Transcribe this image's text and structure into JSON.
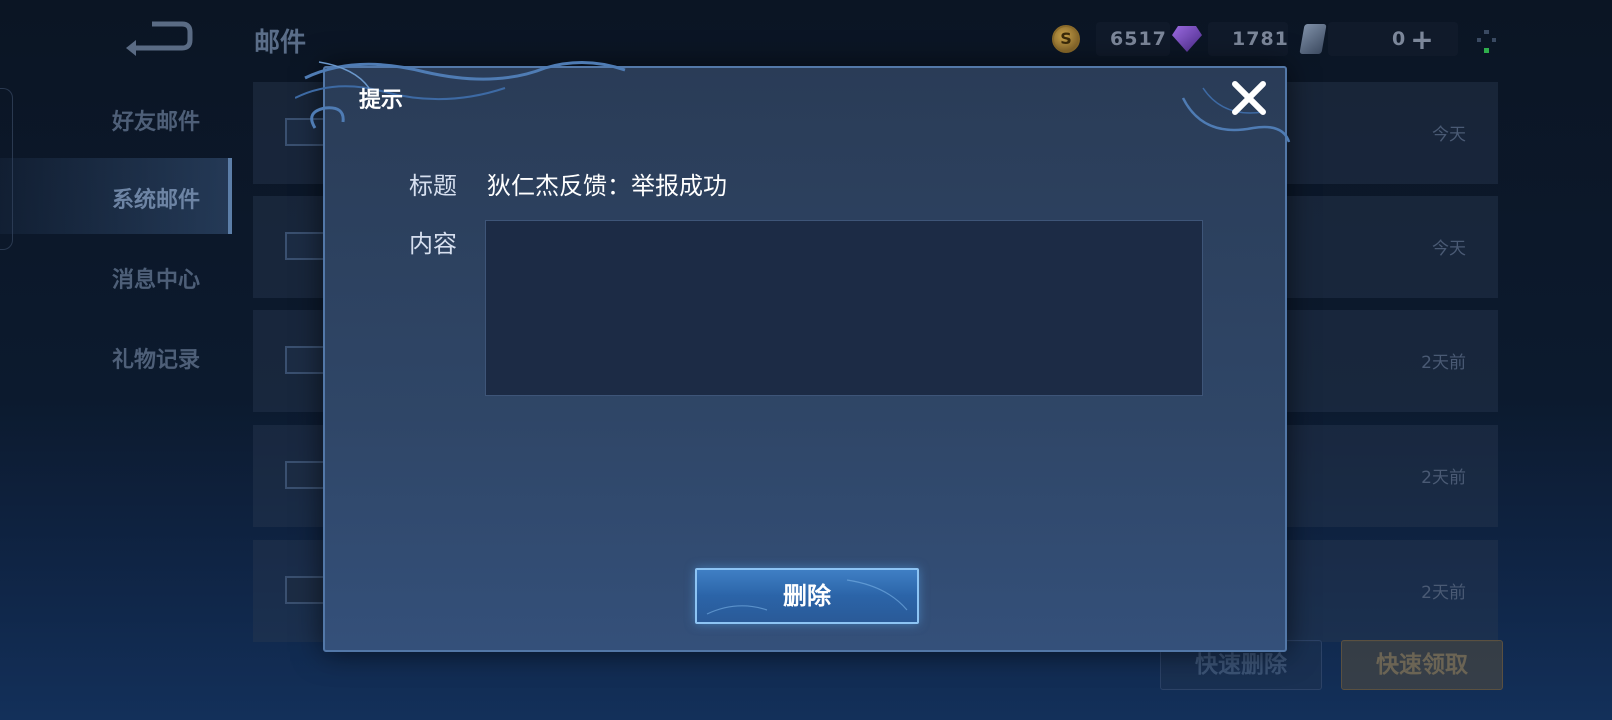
{
  "header": {
    "page_title": "邮件",
    "gold": "6517",
    "diamonds": "1781",
    "vouchers": "0",
    "plus_symbol": "+"
  },
  "sidebar": {
    "items": [
      {
        "label": "好友邮件",
        "active": false
      },
      {
        "label": "系统邮件",
        "active": true
      },
      {
        "label": "消息中心",
        "active": false
      },
      {
        "label": "礼物记录",
        "active": false
      }
    ]
  },
  "mail_list": {
    "rows": [
      {
        "date": "今天"
      },
      {
        "date": "今天"
      },
      {
        "date": "2天前"
      },
      {
        "date": "2天前"
      },
      {
        "date": "2天前"
      }
    ]
  },
  "footer": {
    "quick_delete_label": "快速删除",
    "quick_claim_label": "快速领取"
  },
  "dialog": {
    "title": "提示",
    "subject_label": "标题",
    "subject_value": "狄仁杰反馈：举报成功",
    "content_label": "内容",
    "content_value": "",
    "delete_label": "删除"
  },
  "colors": {
    "accent": "#5378a8",
    "button": "#2b64a8"
  },
  "icons": [
    "back-arrow-icon",
    "gold-coin-icon",
    "diamond-icon",
    "voucher-icon",
    "wifi-icon",
    "envelope-icon",
    "close-icon"
  ]
}
